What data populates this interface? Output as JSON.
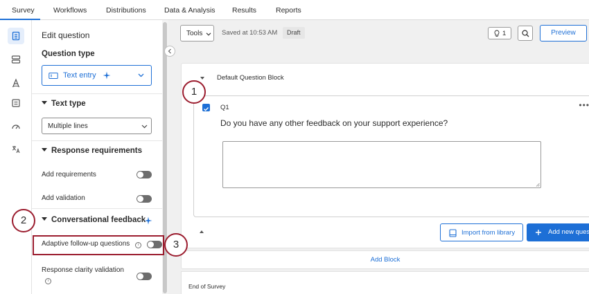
{
  "nav": {
    "tabs": [
      "Survey",
      "Workflows",
      "Distributions",
      "Data & Analysis",
      "Results",
      "Reports"
    ]
  },
  "rail": {
    "icons": [
      "survey-flow-icon",
      "blocks-icon",
      "look-and-feel-icon",
      "survey-options-icon",
      "dashboard-icon",
      "translate-icon"
    ]
  },
  "panel": {
    "title": "Edit question",
    "question_type_label": "Question type",
    "question_type_value": "Text entry",
    "text_type_heading": "Text type",
    "text_type_value": "Multiple lines",
    "response_requirements_heading": "Response requirements",
    "add_requirements": "Add requirements",
    "add_validation": "Add validation",
    "conversational_feedback_heading": "Conversational feedback",
    "adaptive_followup": "Adaptive follow-up questions",
    "response_clarity": "Response clarity validation"
  },
  "toolbar": {
    "tools": "Tools",
    "saved": "Saved at 10:53 AM",
    "draft": "Draft",
    "notes_count": "1",
    "preview": "Preview"
  },
  "block": {
    "title": "Default Question Block",
    "question_number": "Q1",
    "question_text": "Do you have any other feedback on your support experience?",
    "more": "•••",
    "import": "Import from library",
    "add_question": "Add new question",
    "add_block": "Add Block",
    "end_of_survey": "End of Survey"
  },
  "callouts": [
    "1",
    "2",
    "3"
  ],
  "colors": {
    "accent": "#1d6fd6",
    "callout": "#9b1c2e"
  }
}
